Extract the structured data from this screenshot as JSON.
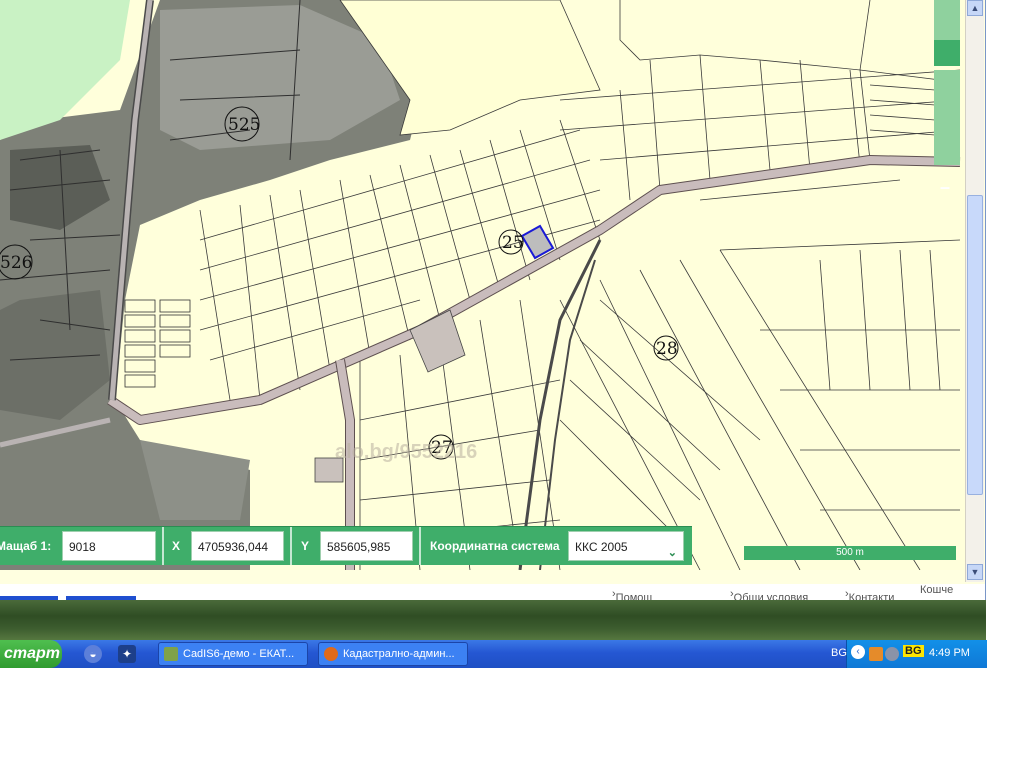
{
  "map": {
    "parcel_labels": [
      "525",
      "526",
      "25",
      "28",
      "27"
    ],
    "watermark": "alo.bg/9552216",
    "zoom_out_label": "–"
  },
  "coord_bar": {
    "scale_label": "Мащаб",
    "scale_prefix": "1:",
    "scale_value": "9018",
    "x_label": "X",
    "x_value": "4705936,044",
    "y_label": "Y",
    "y_value": "585605,985",
    "crs_label": "Координатна система",
    "crs_value": "ККС 2005"
  },
  "scale_bar": {
    "label": "500 m"
  },
  "page_links": {
    "help": "Помощ",
    "terms": "Общи условия",
    "contacts": "Контакти",
    "cart": "Кошче"
  },
  "taskbar": {
    "start_label": "старт",
    "tasks": [
      {
        "label": "CadIS6-демо - ЕКАТ...",
        "icon": "cadis-icon"
      },
      {
        "label": "Кадастрално-админ...",
        "icon": "firefox-icon"
      }
    ],
    "language": "BG",
    "lang_badge": "BG",
    "clock": "4:49 PM"
  },
  "colors": {
    "map_background": "#ffffd9",
    "road": "#c9bcbc",
    "green_panel": "#3fae6a",
    "selected_parcel": "#1a1ad6",
    "taskbar": "#2557d3"
  }
}
